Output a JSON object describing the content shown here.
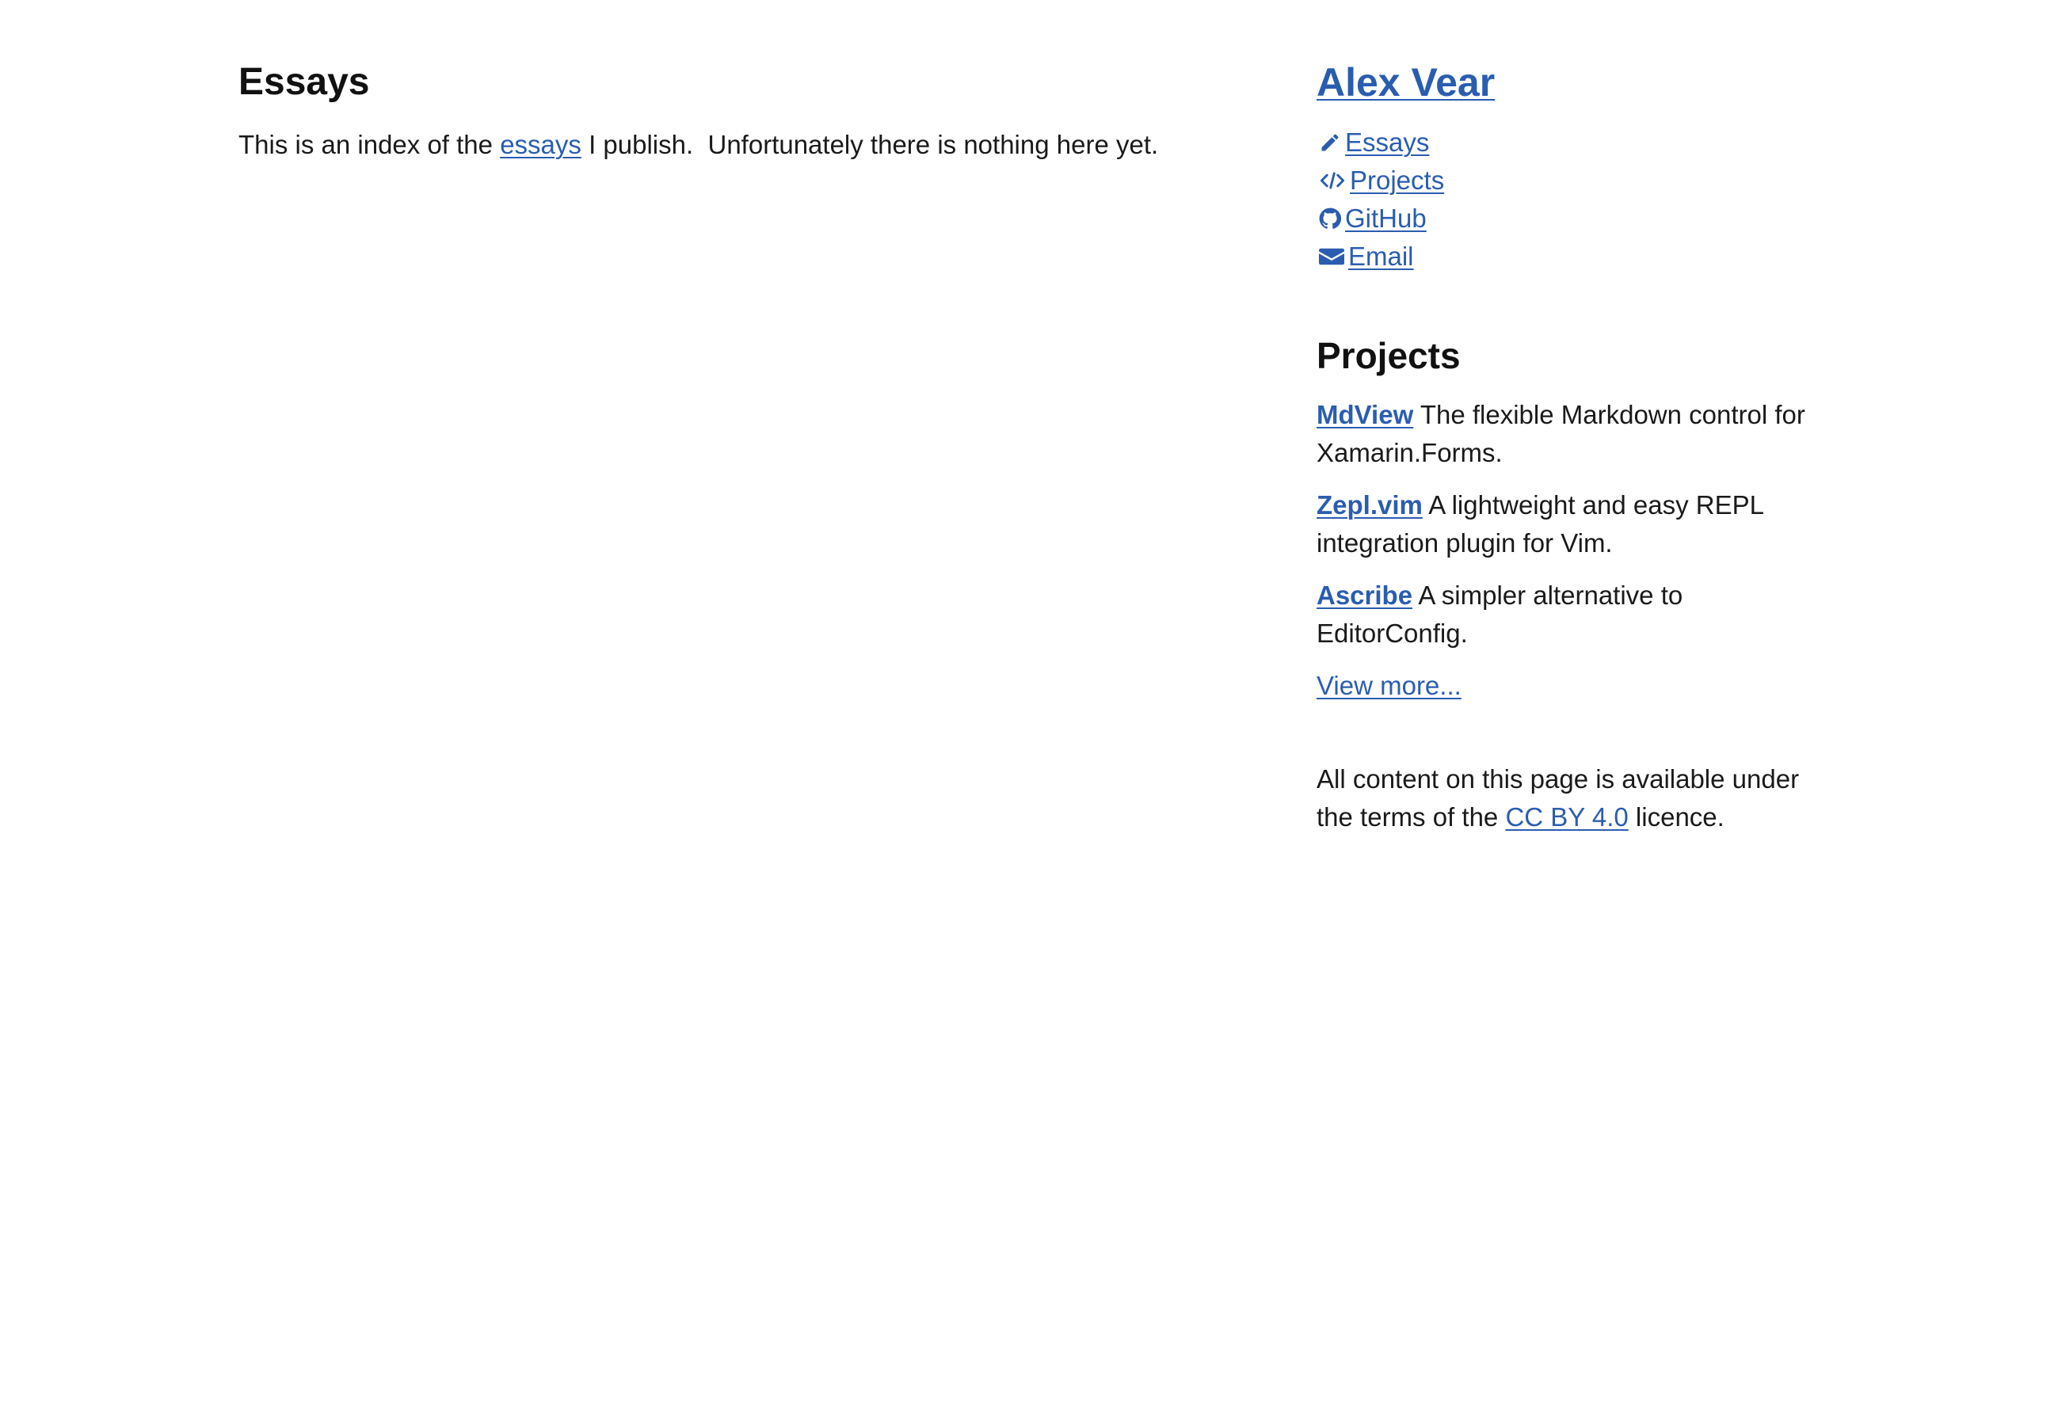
{
  "main": {
    "title": "Essays",
    "intro_before": "This is an index of the ",
    "intro_link": "essays",
    "intro_after": " I publish.  Unfortunately there is nothing here yet."
  },
  "sidebar": {
    "site_title": "Alex Vear",
    "nav": [
      {
        "label": "Essays",
        "icon": "pencil-icon"
      },
      {
        "label": "Projects",
        "icon": "code-icon"
      },
      {
        "label": "GitHub",
        "icon": "github-icon"
      },
      {
        "label": "Email",
        "icon": "envelope-icon"
      }
    ],
    "projects_heading": "Projects",
    "projects": [
      {
        "name": "MdView",
        "description": " The flexible Markdown control for Xamarin.Forms."
      },
      {
        "name": "Zepl.vim",
        "description": " A lightweight and easy REPL integration plugin for Vim."
      },
      {
        "name": "Ascribe",
        "description": " A simpler alternative to EditorConfig."
      }
    ],
    "view_more": "View more...",
    "licence_before": "All content on this page is available under the terms of the ",
    "licence_link": "CC BY 4.0",
    "licence_after": " licence."
  },
  "colors": {
    "link": "#2a5db0",
    "text": "#1a1a1a"
  }
}
